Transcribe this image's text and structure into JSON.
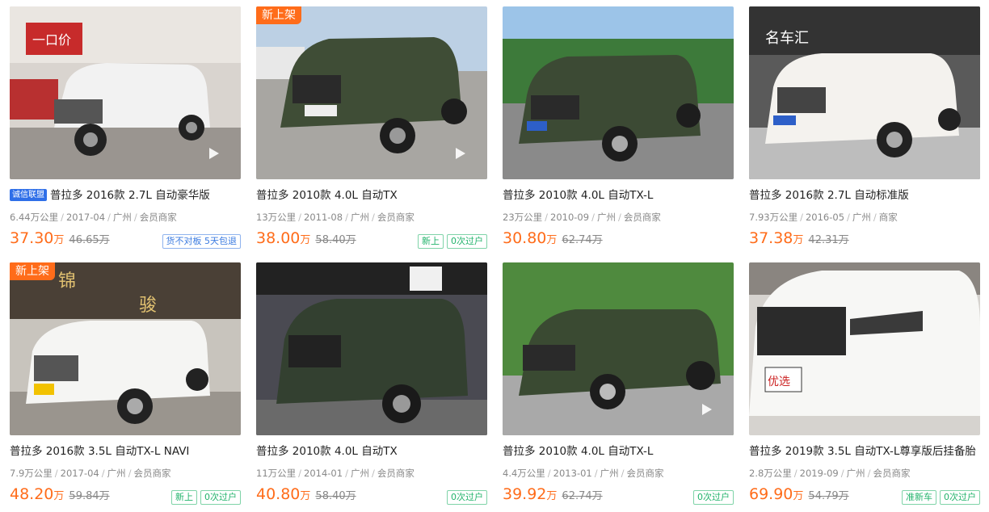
{
  "badge_new": "新上架",
  "cards": [
    {
      "title": "普拉多 2016款 2.7L 自动豪华版",
      "cert": "诚信联盟",
      "mileage": "6.44万公里",
      "date": "2017-04",
      "city": "广州",
      "seller": "会员商家",
      "price": "37.30",
      "unit": "万",
      "old": "46.65万",
      "tags": [
        "货不对板 5天包退"
      ]
    },
    {
      "title": "普拉多 2010款 4.0L 自动TX",
      "mileage": "13万公里",
      "date": "2011-08",
      "city": "广州",
      "seller": "会员商家",
      "price": "38.00",
      "unit": "万",
      "old": "58.40万",
      "tags": [
        "新上",
        "0次过户"
      ]
    },
    {
      "title": "普拉多 2010款 4.0L 自动TX-L",
      "mileage": "23万公里",
      "date": "2010-09",
      "city": "广州",
      "seller": "会员商家",
      "price": "30.80",
      "unit": "万",
      "old": "62.74万",
      "tags": []
    },
    {
      "title": "普拉多 2016款 2.7L 自动标准版",
      "mileage": "7.93万公里",
      "date": "2016-05",
      "city": "广州",
      "seller": "商家",
      "price": "37.38",
      "unit": "万",
      "old": "42.31万",
      "tags": []
    },
    {
      "title": "普拉多 2016款 3.5L 自动TX-L NAVI",
      "mileage": "7.9万公里",
      "date": "2017-04",
      "city": "广州",
      "seller": "会员商家",
      "price": "48.20",
      "unit": "万",
      "old": "59.84万",
      "tags": [
        "新上",
        "0次过户"
      ]
    },
    {
      "title": "普拉多 2010款 4.0L 自动TX",
      "mileage": "11万公里",
      "date": "2014-01",
      "city": "广州",
      "seller": "会员商家",
      "price": "40.80",
      "unit": "万",
      "old": "58.40万",
      "tags": [
        "0次过户"
      ]
    },
    {
      "title": "普拉多 2010款 4.0L 自动TX-L",
      "mileage": "4.4万公里",
      "date": "2013-01",
      "city": "广州",
      "seller": "会员商家",
      "price": "39.92",
      "unit": "万",
      "old": "62.74万",
      "tags": [
        "0次过户"
      ]
    },
    {
      "title": "普拉多 2019款 3.5L 自动TX-L尊享版后挂备胎",
      "mileage": "2.8万公里",
      "date": "2019-09",
      "city": "广州",
      "seller": "会员商家",
      "price": "69.90",
      "unit": "万",
      "old": "54.79万",
      "tags": [
        "准新车",
        "0次过户"
      ]
    }
  ],
  "colors": {
    "accent": "#ff6c1a",
    "tag_green": "#22b36b",
    "tag_blue": "#3b7be0",
    "cert_blue": "#2f6fe8"
  }
}
